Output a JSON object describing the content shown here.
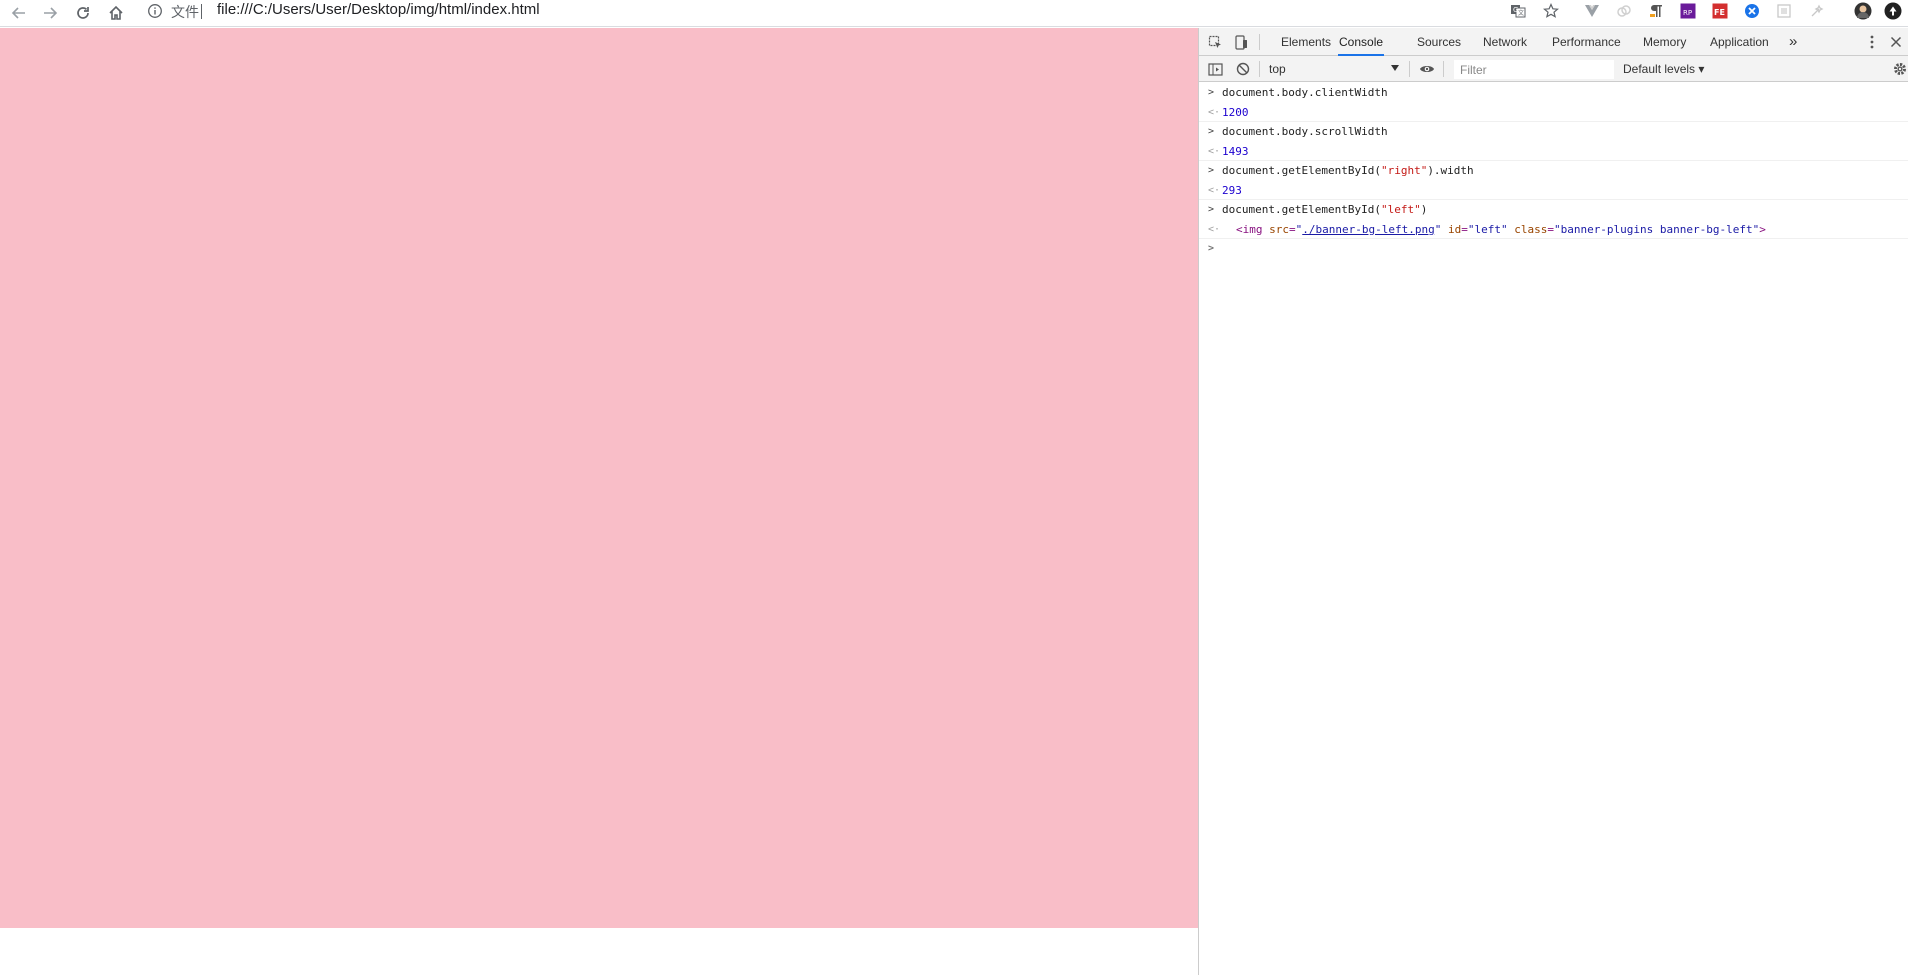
{
  "browser": {
    "protocol_label": "文件",
    "url": "file:///C:/Users/User/Desktop/img/html/index.html",
    "nav": [
      "back-icon",
      "forward-icon",
      "reload-icon",
      "home-icon"
    ],
    "toolbar_icons": [
      "translate-icon",
      "bookmark-star-icon",
      "vue-devtools-icon",
      "extension-icon",
      "paragraph-icon",
      "rp-extension-icon",
      "fe-extension-icon",
      "chrome-extension-icon",
      "extension-icon",
      "extension-icon",
      "profile-avatar-icon",
      "menu-icon"
    ]
  },
  "page": {
    "background_color": "#f9bec8"
  },
  "devtools": {
    "tabs": [
      {
        "label": "Elements",
        "active": false
      },
      {
        "label": "Console",
        "active": true
      },
      {
        "label": "Sources",
        "active": false
      },
      {
        "label": "Network",
        "active": false
      },
      {
        "label": "Performance",
        "active": false
      },
      {
        "label": "Memory",
        "active": false
      },
      {
        "label": "Application",
        "active": false
      }
    ],
    "more_tabs": "»",
    "context": "top",
    "filter_placeholder": "Filter",
    "levels": "Default levels ▾",
    "console": {
      "cmd1": "document.body.clientWidth",
      "res1": "1200",
      "cmd2": "document.body.scrollWidth",
      "res2": "1493",
      "cmd3_pre": "document.getElementById(",
      "cmd3_arg": "\"right\"",
      "cmd3_post": ").width",
      "res3": "293",
      "cmd4_pre": "document.getElementById(",
      "cmd4_arg": "\"left\"",
      "cmd4_post": ")",
      "res4": {
        "tag_open": "<img",
        "src_attr": "src",
        "src_val": "./banner-bg-left.png",
        "id_attr": "id",
        "id_val": "\"left\"",
        "class_attr": "class",
        "class_val": "\"banner-plugins banner-bg-left\"",
        "tag_close": ">"
      }
    }
  }
}
